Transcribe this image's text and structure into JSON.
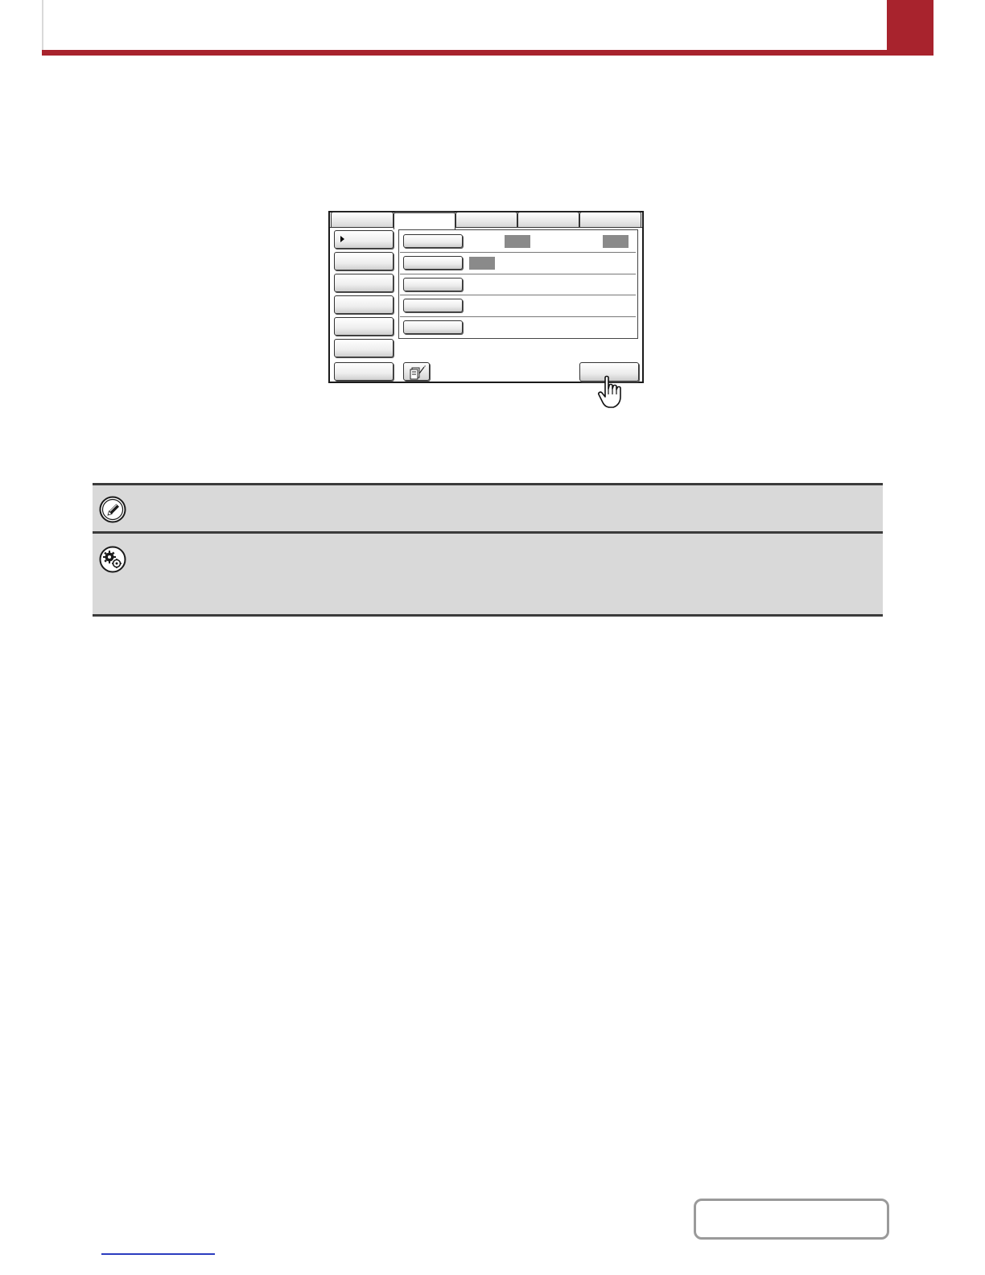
{
  "colors": {
    "header_accent": "#a8232d",
    "note_background": "#d9d9d9",
    "note_rule": "#3b3b3b",
    "chip_gray": "#8a8a8a",
    "link_blue": "#2b3cbf"
  },
  "header": {
    "title": "",
    "tab_label": ""
  },
  "screen": {
    "tabs": [
      "",
      "",
      "",
      "",
      ""
    ],
    "active_tab_index": 1,
    "sidebar_items": [
      "",
      "",
      "",
      "",
      "",
      "",
      ""
    ],
    "selected_sidebar_index": 0,
    "rows": [
      {
        "button": "",
        "values": [
          "",
          ""
        ]
      },
      {
        "button": "",
        "values": [
          ""
        ]
      },
      {
        "button": "",
        "values": []
      },
      {
        "button": "",
        "values": []
      },
      {
        "button": "",
        "values": []
      }
    ],
    "ok_button": "",
    "icons": {
      "bottom_left": "edit-document-icon",
      "pointer": "pointing-hand-icon"
    }
  },
  "notes": [
    {
      "icon": "pencil-note-icon",
      "text": ""
    },
    {
      "icon": "system-settings-gear-icon",
      "text": ""
    }
  ],
  "footer": {
    "contents_label": "",
    "link_text": ""
  }
}
